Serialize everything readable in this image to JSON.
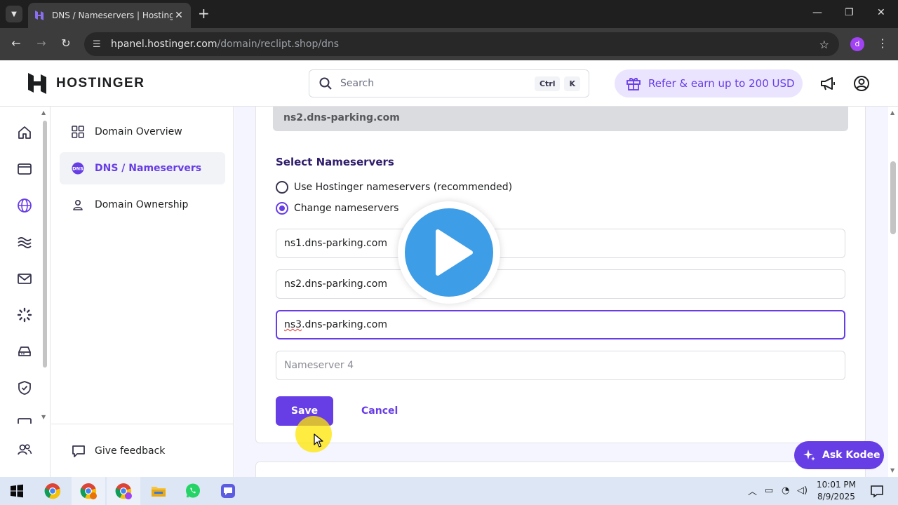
{
  "browser": {
    "tab_title": "DNS / Nameservers | Hostinger",
    "url_host": "hpanel.hostinger.com",
    "url_path": "/domain/reclipt.shop/dns",
    "profile_initial": "d"
  },
  "header": {
    "brand": "HOSTINGER",
    "search_placeholder": "Search",
    "shortcut_ctrl": "Ctrl",
    "shortcut_key": "K",
    "refer_label": "Refer & earn up to 200 USD"
  },
  "sidebar": {
    "items": [
      {
        "label": "Domain Overview"
      },
      {
        "label": "DNS / Nameservers"
      },
      {
        "label": "Domain Ownership"
      }
    ],
    "feedback_label": "Give feedback"
  },
  "main": {
    "current_ns2": "ns2.dns-parking.com",
    "section_title": "Select Nameservers",
    "radio_hostinger": "Use Hostinger nameservers (recommended)",
    "radio_change": "Change nameservers",
    "ns1_value": "ns1.dns-parking.com",
    "ns2_value": "ns2.dns-parking.com",
    "ns3_prefix": "ns3",
    "ns3_rest": ".dns-parking.com",
    "ns4_placeholder": "Nameserver 4",
    "save_label": "Save",
    "cancel_label": "Cancel"
  },
  "kodee_label": "Ask Kodee",
  "taskbar": {
    "time": "10:01 PM",
    "date": "8/9/2025"
  },
  "colors": {
    "accent": "#673de6",
    "accent_light": "#ebe4ff",
    "content_bg": "#f4f5ff",
    "play_blue": "#3d9de6"
  }
}
